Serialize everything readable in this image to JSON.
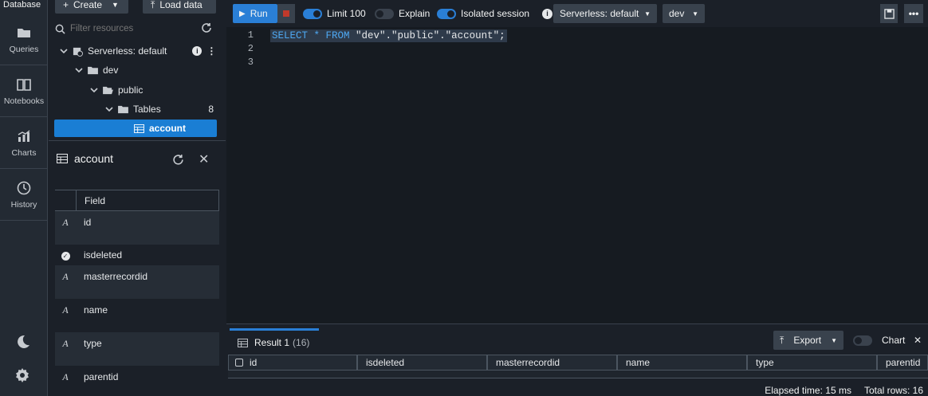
{
  "app": {
    "section_title": "Database"
  },
  "top_buttons": {
    "create": "Create",
    "load_data": "Load data"
  },
  "rail": [
    {
      "label": "Queries",
      "icon": "folder-icon"
    },
    {
      "label": "Notebooks",
      "icon": "book-icon"
    },
    {
      "label": "Charts",
      "icon": "chart-icon"
    },
    {
      "label": "History",
      "icon": "clock-icon"
    }
  ],
  "tree": {
    "filter_placeholder": "Filter resources",
    "nodes": {
      "workgroup": "Serverless: default",
      "database": "dev",
      "schema": "public",
      "tables": "Tables",
      "tables_count": "8",
      "table": "account"
    }
  },
  "field_panel": {
    "title": "account",
    "column_header": "Field",
    "fields": [
      {
        "type": "A",
        "name": "id"
      },
      {
        "type": "check",
        "name": "isdeleted"
      },
      {
        "type": "A",
        "name": "masterrecordid"
      },
      {
        "type": "A",
        "name": "name"
      },
      {
        "type": "A",
        "name": "type"
      },
      {
        "type": "A",
        "name": "parentid"
      }
    ]
  },
  "toolbar": {
    "run": "Run",
    "limit": "Limit 100",
    "explain": "Explain",
    "isolated": "Isolated session",
    "workgroup_select": "Serverless: default",
    "database_select": "dev"
  },
  "editor": {
    "line_numbers": [
      "1",
      "2",
      "3"
    ],
    "query_kw1": "SELECT",
    "query_star": " * ",
    "query_kw2": "FROM",
    "query_rest": " \"dev\".\"public\".\"account\";"
  },
  "results": {
    "tab_label": "Result 1",
    "tab_count": "(16)",
    "export": "Export",
    "chart": "Chart",
    "columns": [
      "id",
      "isdeleted",
      "masterrecordid",
      "name",
      "type",
      "parentid"
    ],
    "elapsed": "Elapsed time: 15 ms",
    "total_rows": "Total rows: 16"
  },
  "colors": {
    "accent": "#2a7fd6",
    "selected": "#1a7ed4",
    "stop": "#c0392b"
  }
}
